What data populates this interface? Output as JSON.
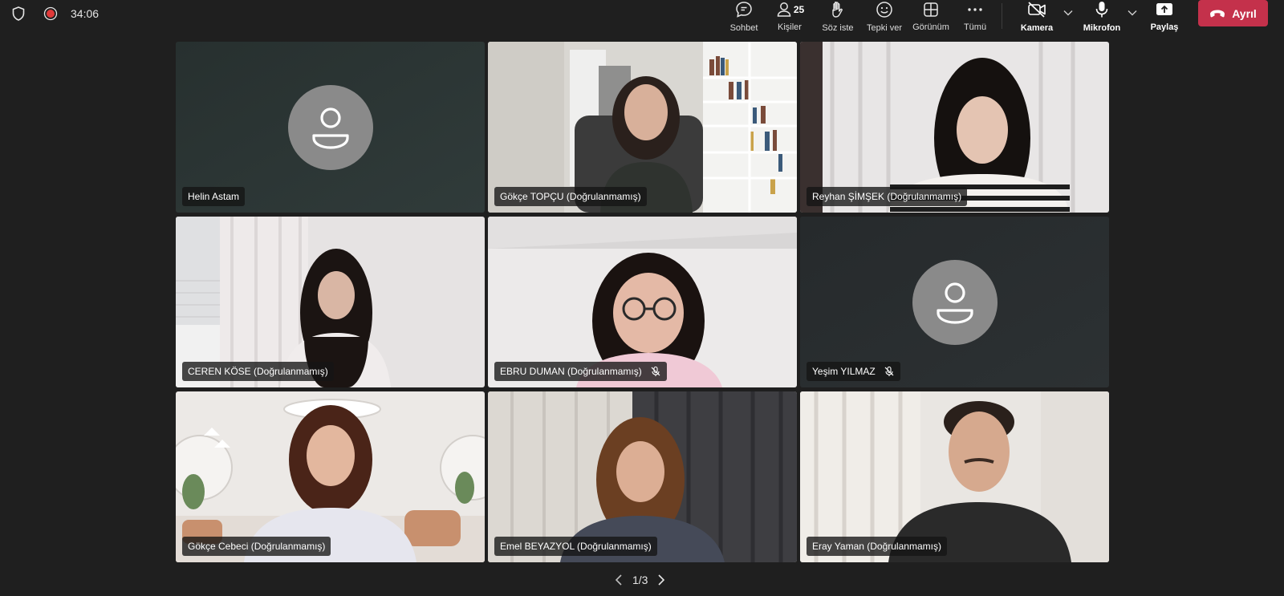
{
  "status": {
    "timer": "34:06",
    "shield_icon": "shield-icon",
    "recording_icon": "recording-icon"
  },
  "toolbar": {
    "chat": {
      "label": "Sohbet",
      "icon": "chat-bubble-icon"
    },
    "people": {
      "label": "Kişiler",
      "count": "25",
      "icon": "people-icon"
    },
    "raise_hand": {
      "label": "Söz iste",
      "icon": "raise-hand-icon"
    },
    "react": {
      "label": "Tepki ver",
      "icon": "smiley-icon"
    },
    "view": {
      "label": "Görünüm",
      "icon": "grid-view-icon"
    },
    "more": {
      "label": "Tümü",
      "icon": "more-icon"
    },
    "camera": {
      "label": "Kamera",
      "icon": "camera-off-icon"
    },
    "mic": {
      "label": "Mikrofon",
      "icon": "microphone-icon"
    },
    "share": {
      "label": "Paylaş",
      "icon": "share-screen-icon"
    },
    "leave": {
      "label": "Ayrıl",
      "icon": "hang-up-icon",
      "color": "#c4314b"
    }
  },
  "participants": [
    {
      "name": "Helin Astam",
      "video": false,
      "muted": false
    },
    {
      "name": "Gökçe TOPÇU (Doğrulanmamış)",
      "video": true,
      "muted": false
    },
    {
      "name": "Reyhan ŞİMŞEK (Doğrulanmamış)",
      "video": true,
      "muted": false
    },
    {
      "name": "CEREN KÖSE (Doğrulanmamış)",
      "video": true,
      "muted": false
    },
    {
      "name": "EBRU DUMAN (Doğrulanmamış)",
      "video": true,
      "muted": true
    },
    {
      "name": "Yeşim YILMAZ",
      "video": false,
      "muted": true
    },
    {
      "name": "Gökçe Cebeci (Doğrulanmamış)",
      "video": true,
      "muted": false
    },
    {
      "name": "Emel BEYAZYOL (Doğrulanmamış)",
      "video": true,
      "muted": false
    },
    {
      "name": "Eray Yaman (Doğrulanmamış)",
      "video": true,
      "muted": false
    }
  ],
  "pager": {
    "label": "1/3"
  },
  "colors": {
    "background": "#1f1f1f",
    "leave_button": "#c4314b",
    "avatar": "#8a8a8a"
  }
}
